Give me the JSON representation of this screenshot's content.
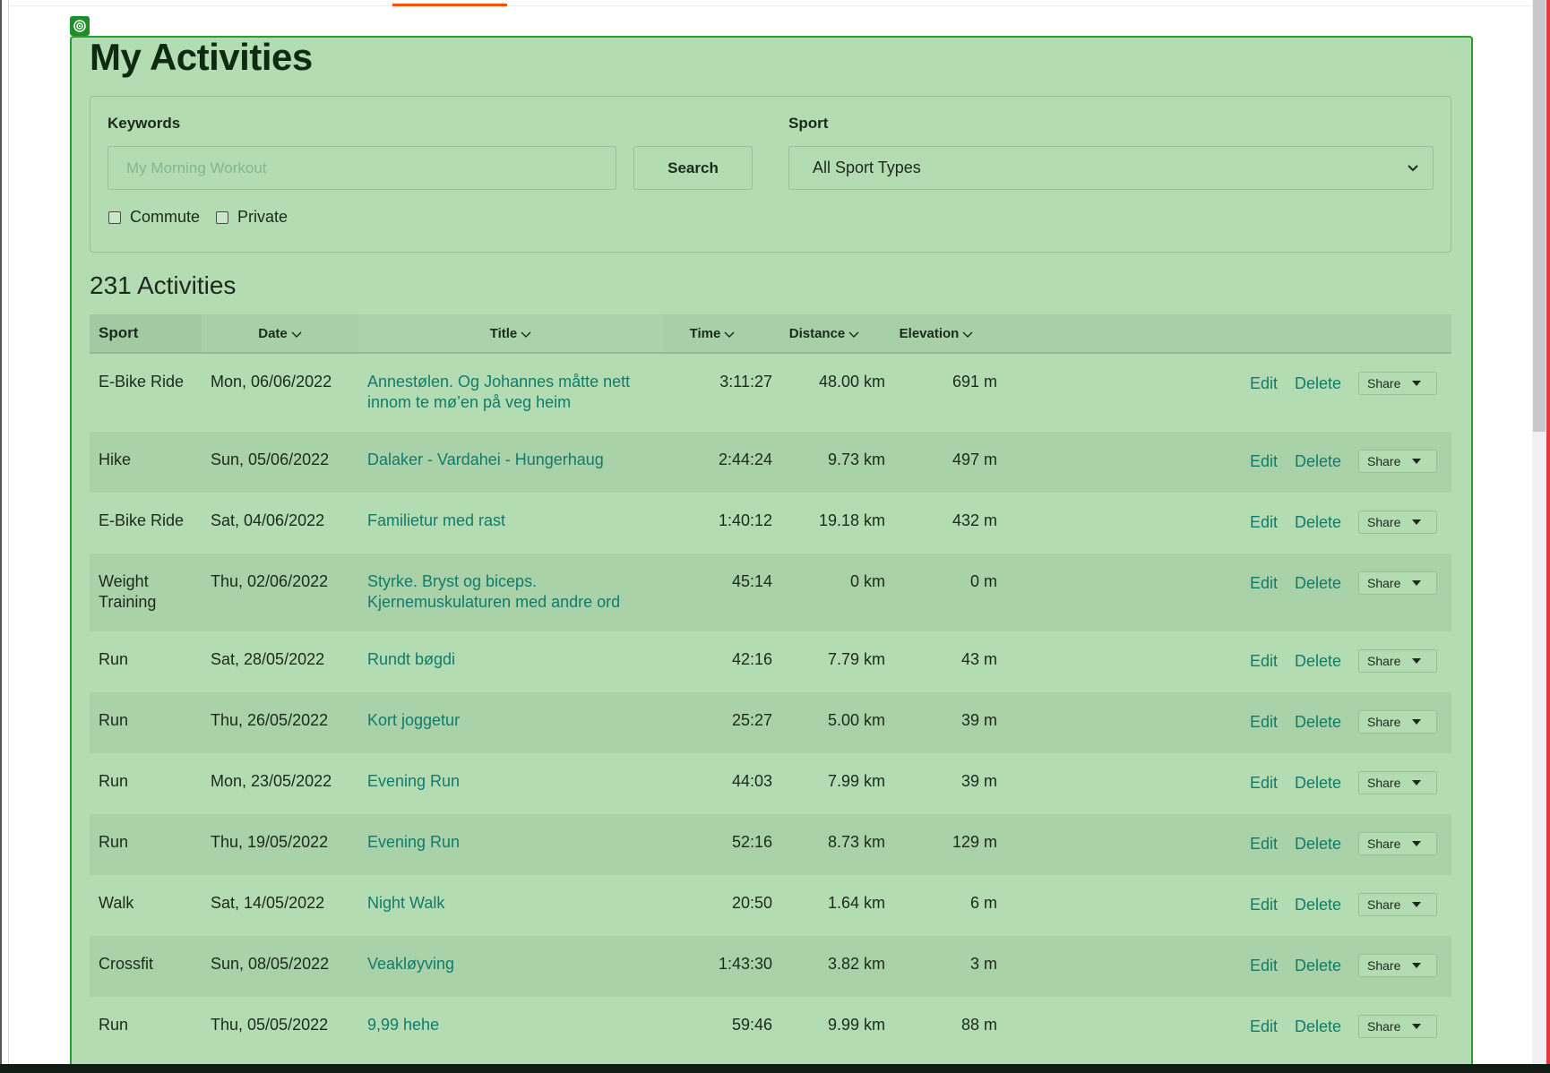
{
  "page_title": "My Activities",
  "filters": {
    "keywords_label": "Keywords",
    "keywords_placeholder": "My Morning Workout",
    "search_label": "Search",
    "sport_label": "Sport",
    "sport_selected": "All Sport Types",
    "commute_label": "Commute",
    "private_label": "Private"
  },
  "activities_count": "231 Activities",
  "table": {
    "headers": {
      "sport": "Sport",
      "date": "Date",
      "title": "Title",
      "time": "Time",
      "distance": "Distance",
      "elevation": "Elevation"
    },
    "rows": [
      {
        "sport": "E-Bike Ride",
        "date": "Mon, 06/06/2022",
        "title": "Annestølen. Og Johannes måtte nett innom te mø’en på veg heim",
        "time": "3:11:27",
        "distance": "48.00 km",
        "elevation": "691 m"
      },
      {
        "sport": "Hike",
        "date": "Sun, 05/06/2022",
        "title": "Dalaker - Vardahei - Hungerhaug",
        "time": "2:44:24",
        "distance": "9.73 km",
        "elevation": "497 m"
      },
      {
        "sport": "E-Bike Ride",
        "date": "Sat, 04/06/2022",
        "title": "Familietur med rast",
        "time": "1:40:12",
        "distance": "19.18 km",
        "elevation": "432 m"
      },
      {
        "sport": "Weight Training",
        "date": "Thu, 02/06/2022",
        "title": "Styrke. Bryst og biceps. Kjernemuskulaturen med andre ord",
        "time": "45:14",
        "distance": "0 km",
        "elevation": "0 m"
      },
      {
        "sport": "Run",
        "date": "Sat, 28/05/2022",
        "title": "Rundt bøgdi",
        "time": "42:16",
        "distance": "7.79 km",
        "elevation": "43 m"
      },
      {
        "sport": "Run",
        "date": "Thu, 26/05/2022",
        "title": "Kort joggetur",
        "time": "25:27",
        "distance": "5.00 km",
        "elevation": "39 m"
      },
      {
        "sport": "Run",
        "date": "Mon, 23/05/2022",
        "title": "Evening Run",
        "time": "44:03",
        "distance": "7.99 km",
        "elevation": "39 m"
      },
      {
        "sport": "Run",
        "date": "Thu, 19/05/2022",
        "title": "Evening Run",
        "time": "52:16",
        "distance": "8.73 km",
        "elevation": "129 m"
      },
      {
        "sport": "Walk",
        "date": "Sat, 14/05/2022",
        "title": "Night Walk",
        "time": "20:50",
        "distance": "1.64 km",
        "elevation": "6 m"
      },
      {
        "sport": "Crossfit",
        "date": "Sun, 08/05/2022",
        "title": "Veakløyving",
        "time": "1:43:30",
        "distance": "3.82 km",
        "elevation": "3 m"
      },
      {
        "sport": "Run",
        "date": "Thu, 05/05/2022",
        "title": "9,99 hehe",
        "time": "59:46",
        "distance": "9.99 km",
        "elevation": "88 m"
      }
    ],
    "actions": {
      "edit_label": "Edit",
      "delete_label": "Delete",
      "share_label": "Share"
    }
  },
  "colors": {
    "overlay_bg": "#b3dcb3",
    "overlay_border": "#2e9b36",
    "link": "#137b6b",
    "brand_indicator": "#fc5200"
  },
  "icons": {
    "corner_marker": "target-icon",
    "sort": "chevron-down-icon",
    "select": "chevron-down-icon",
    "share": "caret-down-icon"
  }
}
